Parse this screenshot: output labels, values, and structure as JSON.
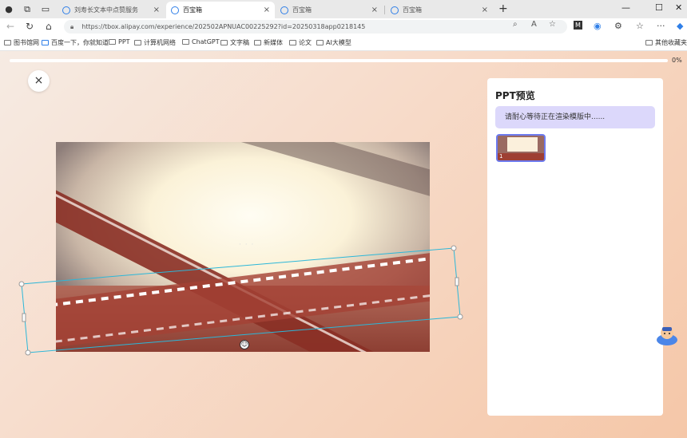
{
  "browser": {
    "tabs": [
      {
        "title": "刘寿长文本中点赞服务",
        "active": false
      },
      {
        "title": "百宝箱",
        "active": true
      },
      {
        "title": "百宝箱",
        "active": false
      },
      {
        "title": "百宝箱",
        "active": false
      }
    ],
    "new_tab_label": "+",
    "url": "https://tbox.alipay.com/experience/202502APNUAC00225292?id=20250318app0218145",
    "bookmarks": [
      "图书馆网",
      "百度一下，你就知道",
      "PPT",
      "计算机网络",
      "ChatGPT",
      "文字稿",
      "新媒体",
      "论文",
      "AI大模型"
    ],
    "other_bookmarks": "其他收藏夹"
  },
  "page": {
    "progress": {
      "value": 0.0,
      "label": "0%"
    },
    "close_label": "×",
    "loader_text": "· · ·",
    "panel": {
      "title": "PPT预览",
      "notice": "请耐心等待正在渲染模版中......",
      "slides": [
        {
          "number": "1"
        }
      ]
    }
  },
  "colors": {
    "accent": "#5b6cf0",
    "notice_bg": "#dcd8fb",
    "selection": "#2bb7d9",
    "page_bg_start": "#f6ebe3",
    "page_bg_end": "#f5c7a8"
  }
}
